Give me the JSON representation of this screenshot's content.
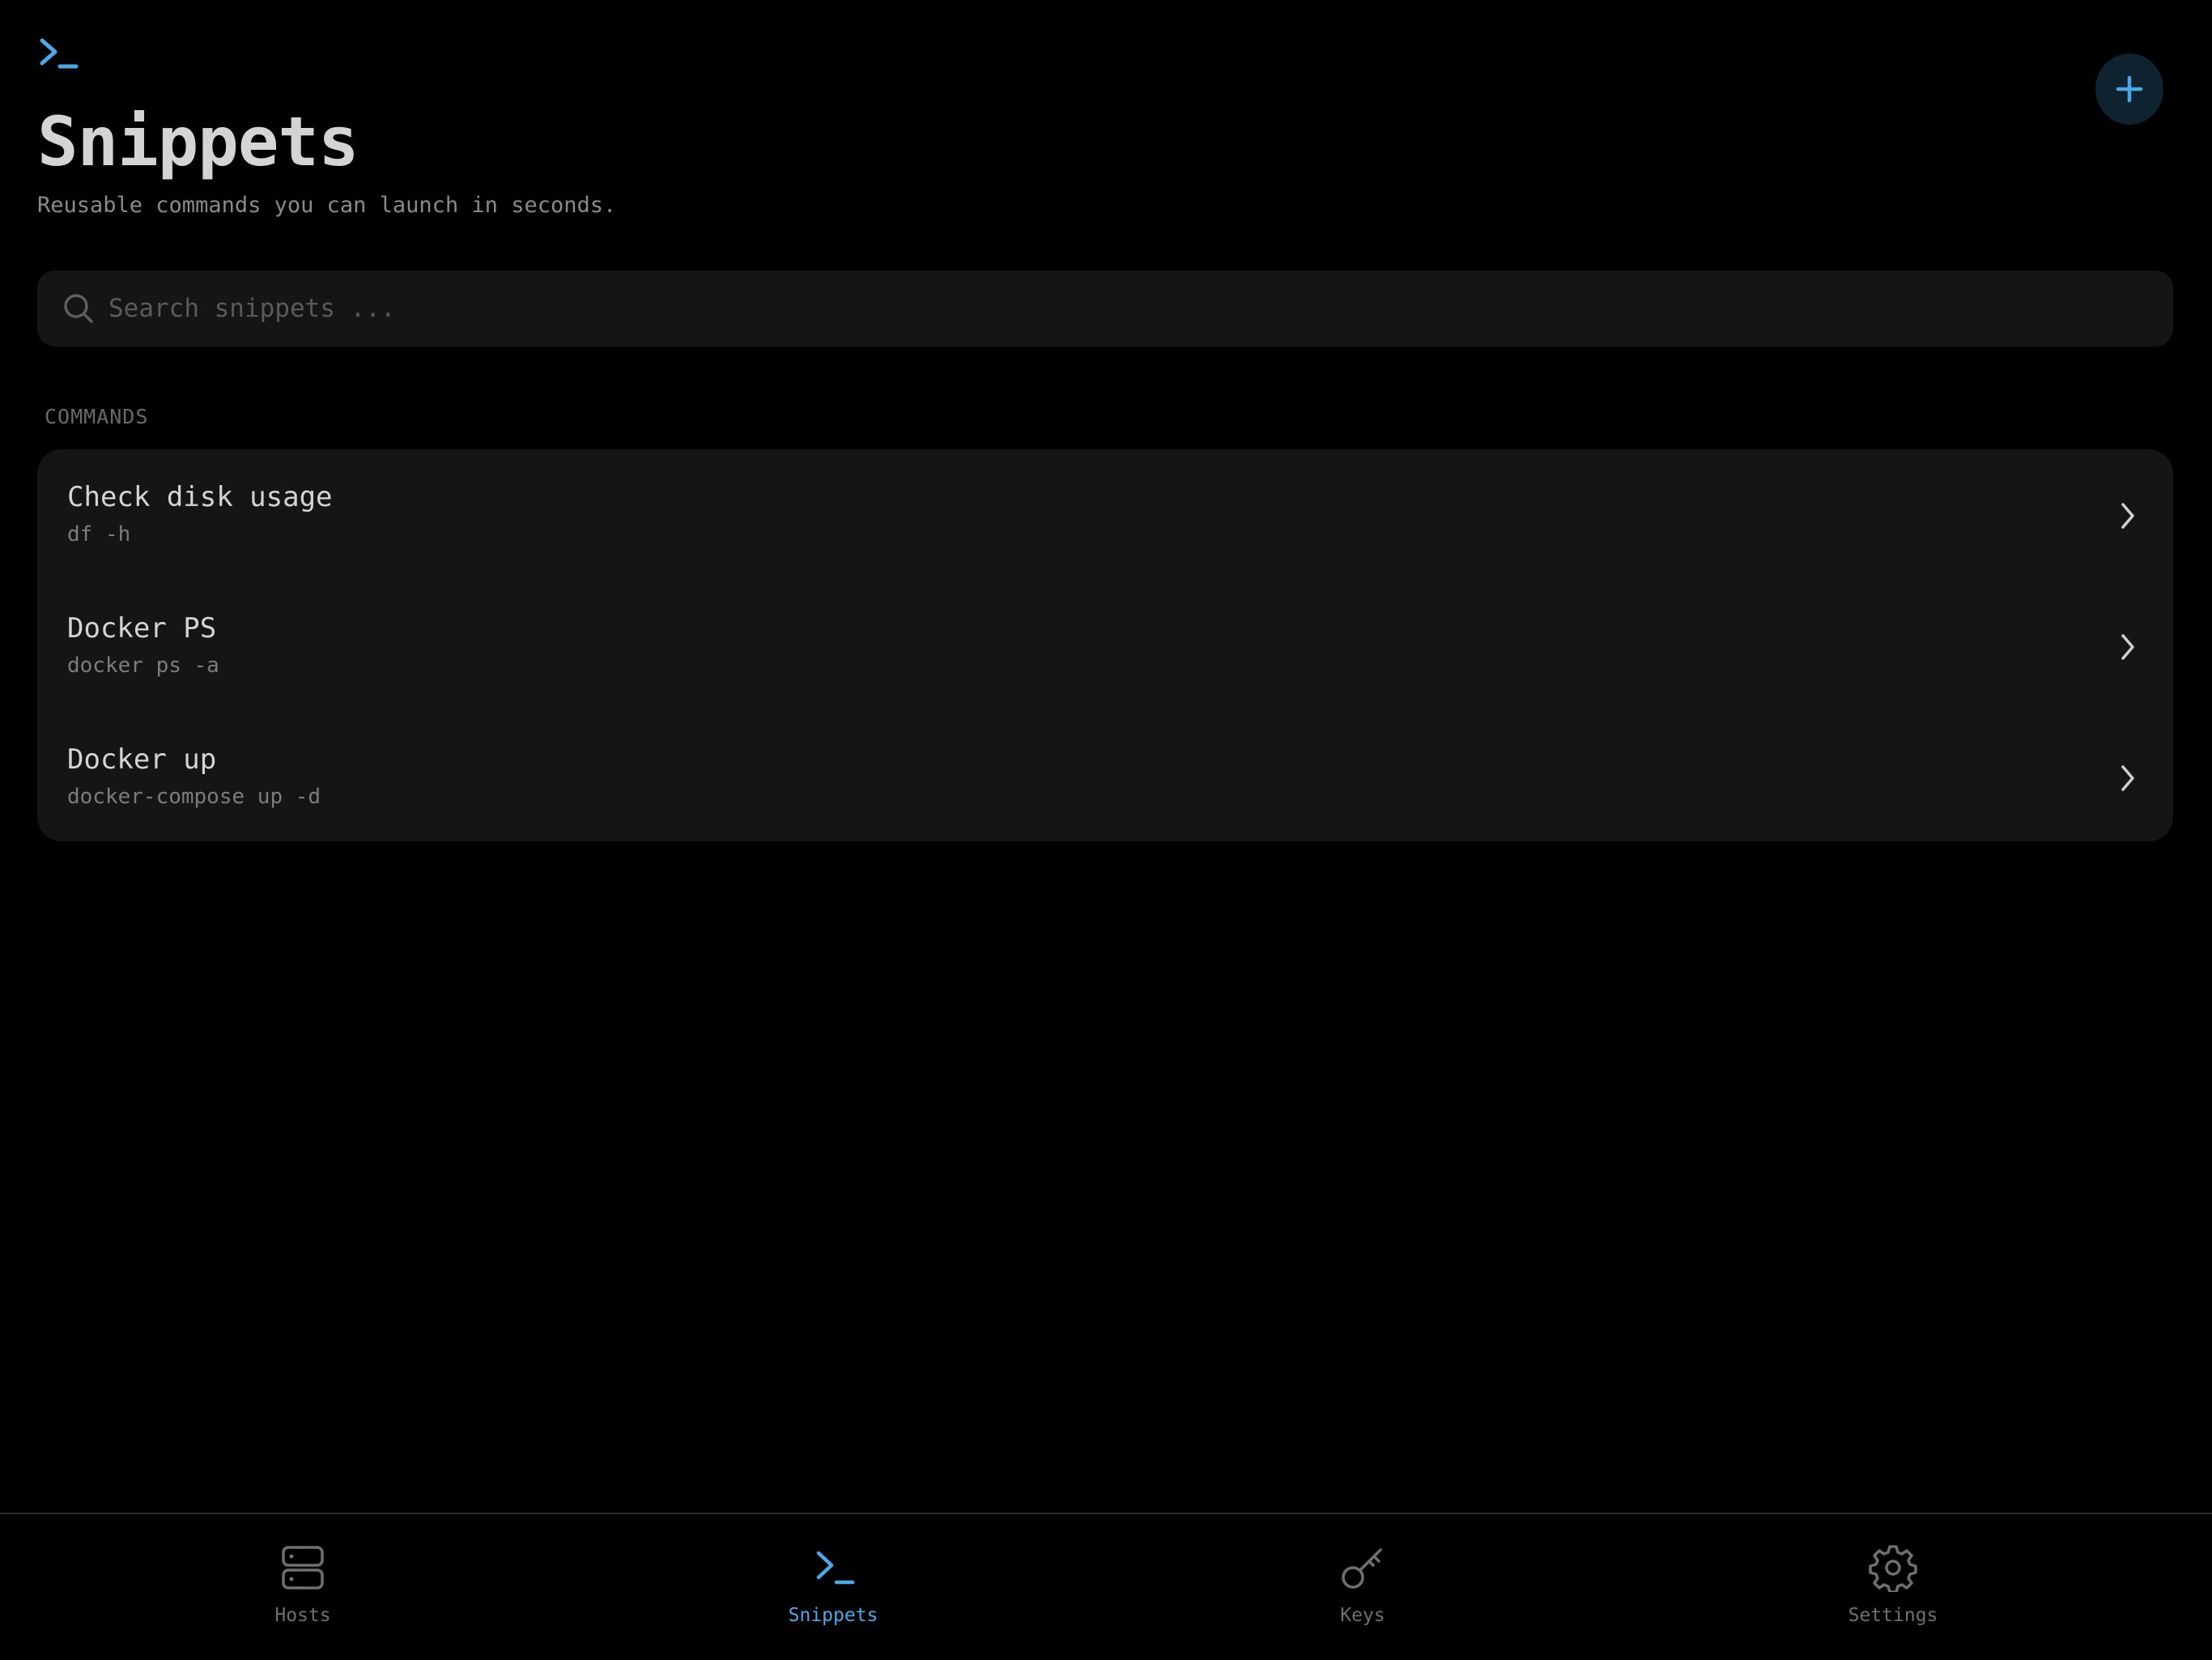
{
  "header": {
    "logo_icon": "terminal-prompt-icon",
    "title": "Snippets",
    "subtitle": "Reusable commands you can launch in seconds.",
    "add_button_icon": "plus-icon"
  },
  "search": {
    "placeholder": "Search snippets ...",
    "value": "",
    "icon": "search-icon"
  },
  "commands": {
    "section_label": "COMMANDS",
    "items": [
      {
        "title": "Check disk usage",
        "command": "df -h",
        "icon": "chevron-right-icon"
      },
      {
        "title": "Docker PS",
        "command": "docker ps -a",
        "icon": "chevron-right-icon"
      },
      {
        "title": "Docker up",
        "command": "docker-compose up -d",
        "icon": "chevron-right-icon"
      }
    ]
  },
  "tab_bar": {
    "active_tab": "Snippets",
    "tabs": [
      {
        "label": "Hosts",
        "icon": "server-icon"
      },
      {
        "label": "Snippets",
        "icon": "terminal-prompt-icon"
      },
      {
        "label": "Keys",
        "icon": "key-icon"
      },
      {
        "label": "Settings",
        "icon": "gear-icon"
      }
    ]
  },
  "colors": {
    "background": "#000000",
    "surface": "#151515",
    "accent": "#4aa8e8",
    "add_button_background": "#0f2230",
    "primary_text": "#d4d4d4",
    "secondary_text": "#7c7c7c",
    "inactive_tab": "#6f6f6f"
  }
}
